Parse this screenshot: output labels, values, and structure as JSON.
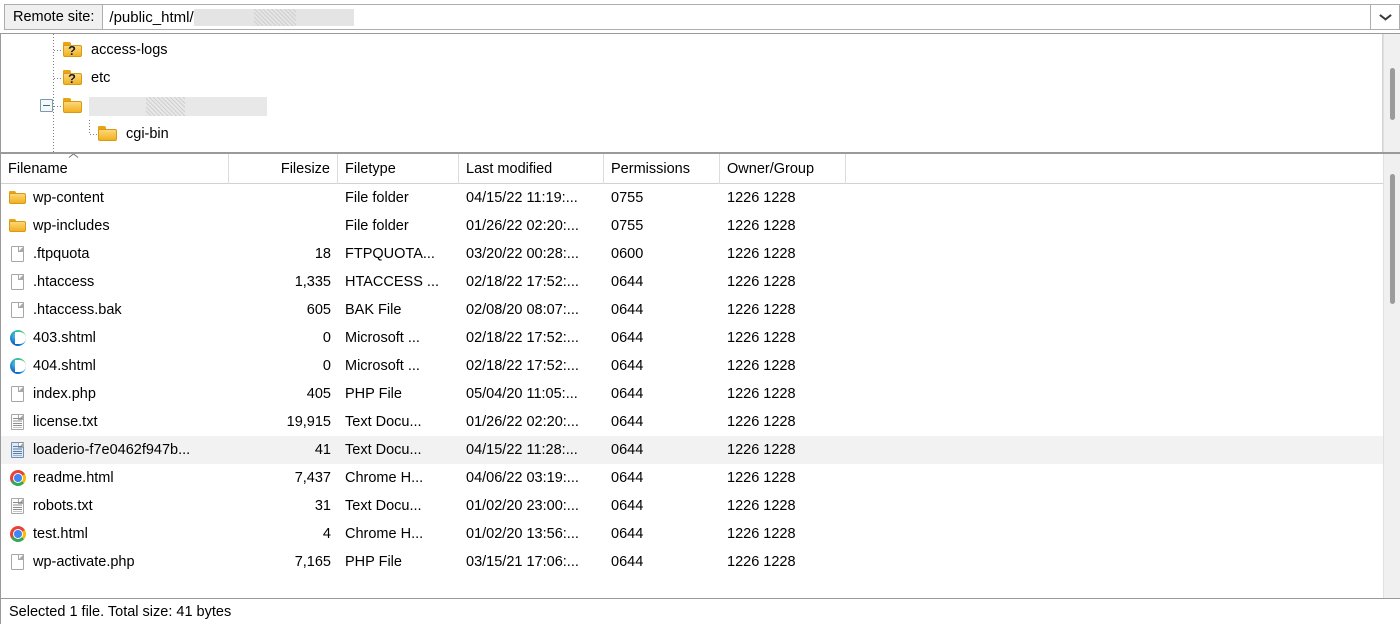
{
  "address_bar": {
    "label": "Remote site:",
    "path": "/public_html/",
    "redacted": true,
    "dropdown_icon": "chevron-down-icon"
  },
  "tree": {
    "nodes": [
      {
        "label": "access-logs",
        "icon": "folder-unknown-icon",
        "indent": 1,
        "expander": "none"
      },
      {
        "label": "etc",
        "icon": "folder-unknown-icon",
        "indent": 1,
        "expander": "none"
      },
      {
        "label": "",
        "redacted": true,
        "icon": "folder-icon",
        "indent": 1,
        "expander": "collapse"
      },
      {
        "label": "cgi-bin",
        "icon": "folder-icon",
        "indent": 2,
        "expander": "none"
      }
    ]
  },
  "file_list": {
    "columns": [
      {
        "label": "Filename",
        "align": "left",
        "sorted": "asc"
      },
      {
        "label": "Filesize",
        "align": "right"
      },
      {
        "label": "Filetype",
        "align": "left"
      },
      {
        "label": "Last modified",
        "align": "left"
      },
      {
        "label": "Permissions",
        "align": "left"
      },
      {
        "label": "Owner/Group",
        "align": "left"
      }
    ],
    "rows": [
      {
        "name": "wp-content",
        "icon": "folder-icon",
        "size": "",
        "type": "File folder",
        "modified": "04/15/22 11:19:...",
        "permissions": "0755",
        "owner": "1226 1228",
        "selected": false
      },
      {
        "name": "wp-includes",
        "icon": "folder-icon",
        "size": "",
        "type": "File folder",
        "modified": "01/26/22 02:20:...",
        "permissions": "0755",
        "owner": "1226 1228",
        "selected": false
      },
      {
        "name": ".ftpquota",
        "icon": "generic-file-icon",
        "size": "18",
        "type": "FTPQUOTA...",
        "modified": "03/20/22 00:28:...",
        "permissions": "0600",
        "owner": "1226 1228",
        "selected": false
      },
      {
        "name": ".htaccess",
        "icon": "generic-file-icon",
        "size": "1,335",
        "type": "HTACCESS ...",
        "modified": "02/18/22 17:52:...",
        "permissions": "0644",
        "owner": "1226 1228",
        "selected": false
      },
      {
        "name": ".htaccess.bak",
        "icon": "generic-file-icon",
        "size": "605",
        "type": "BAK File",
        "modified": "02/08/20 08:07:...",
        "permissions": "0644",
        "owner": "1226 1228",
        "selected": false
      },
      {
        "name": "403.shtml",
        "icon": "edge-icon",
        "size": "0",
        "type": "Microsoft ...",
        "modified": "02/18/22 17:52:...",
        "permissions": "0644",
        "owner": "1226 1228",
        "selected": false
      },
      {
        "name": "404.shtml",
        "icon": "edge-icon",
        "size": "0",
        "type": "Microsoft ...",
        "modified": "02/18/22 17:52:...",
        "permissions": "0644",
        "owner": "1226 1228",
        "selected": false
      },
      {
        "name": "index.php",
        "icon": "generic-file-icon",
        "size": "405",
        "type": "PHP File",
        "modified": "05/04/20 11:05:...",
        "permissions": "0644",
        "owner": "1226 1228",
        "selected": false
      },
      {
        "name": "license.txt",
        "icon": "text-document-icon",
        "size": "19,915",
        "type": "Text Docu...",
        "modified": "01/26/22 02:20:...",
        "permissions": "0644",
        "owner": "1226 1228",
        "selected": false
      },
      {
        "name": "loaderio-f7e0462f947b...",
        "icon": "text-document-icon-selected",
        "size": "41",
        "type": "Text Docu...",
        "modified": "04/15/22 11:28:...",
        "permissions": "0644",
        "owner": "1226 1228",
        "selected": true
      },
      {
        "name": "readme.html",
        "icon": "chrome-icon",
        "size": "7,437",
        "type": "Chrome H...",
        "modified": "04/06/22 03:19:...",
        "permissions": "0644",
        "owner": "1226 1228",
        "selected": false
      },
      {
        "name": "robots.txt",
        "icon": "text-document-icon",
        "size": "31",
        "type": "Text Docu...",
        "modified": "01/02/20 23:00:...",
        "permissions": "0644",
        "owner": "1226 1228",
        "selected": false
      },
      {
        "name": "test.html",
        "icon": "chrome-icon",
        "size": "4",
        "type": "Chrome H...",
        "modified": "01/02/20 13:56:...",
        "permissions": "0644",
        "owner": "1226 1228",
        "selected": false
      },
      {
        "name": "wp-activate.php",
        "icon": "generic-file-icon",
        "size": "7,165",
        "type": "PHP File",
        "modified": "03/15/21 17:06:...",
        "permissions": "0644",
        "owner": "1226 1228",
        "selected": false
      }
    ]
  },
  "status_bar": {
    "text": "Selected 1 file. Total size: 41 bytes"
  },
  "colors": {
    "selection": "#f2f2f2",
    "folder": "#f2b01e",
    "border": "#9a9a9a",
    "scrollbar_thumb": "#9b9b9b"
  }
}
